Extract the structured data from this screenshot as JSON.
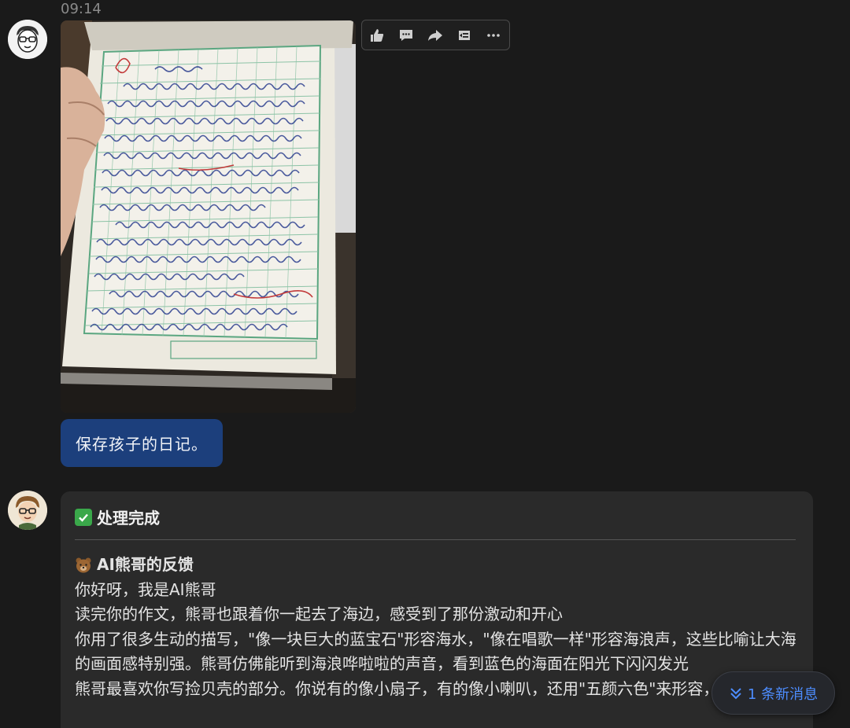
{
  "header": {
    "timestamp": "09:14"
  },
  "toolbar": {
    "actions": [
      "thumbs-up-icon",
      "comment-icon",
      "forward-icon",
      "quote-icon",
      "more-icon"
    ]
  },
  "user_message": {
    "text": "保存孩子的日记。"
  },
  "bot_message": {
    "status": "处理完成",
    "feedback_title": "AI熊哥的反馈",
    "lines": [
      "你好呀，我是AI熊哥",
      "读完你的作文，熊哥也跟着你一起去了海边，感受到了那份激动和开心",
      "你用了很多生动的描写，\"像一块巨大的蓝宝石\"形容海水，\"像在唱歌一样\"形容海浪声，这些比喻让大海的画面感特别强。熊哥仿佛能听到海浪哗啦啦的声音，看到蓝色的海面在阳光下闪闪发光",
      "熊哥最喜欢你写捡贝壳的部分。你说有的像小扇子，有的像小喇叭，还用\"五颜六色\"来形容，这"
    ]
  },
  "new_messages": {
    "label": "1 条新消息"
  },
  "colors": {
    "background": "#1a1a1a",
    "user_bubble": "#1c3f7c",
    "bot_card": "#2a2a2a",
    "accent": "#4d8dff"
  }
}
